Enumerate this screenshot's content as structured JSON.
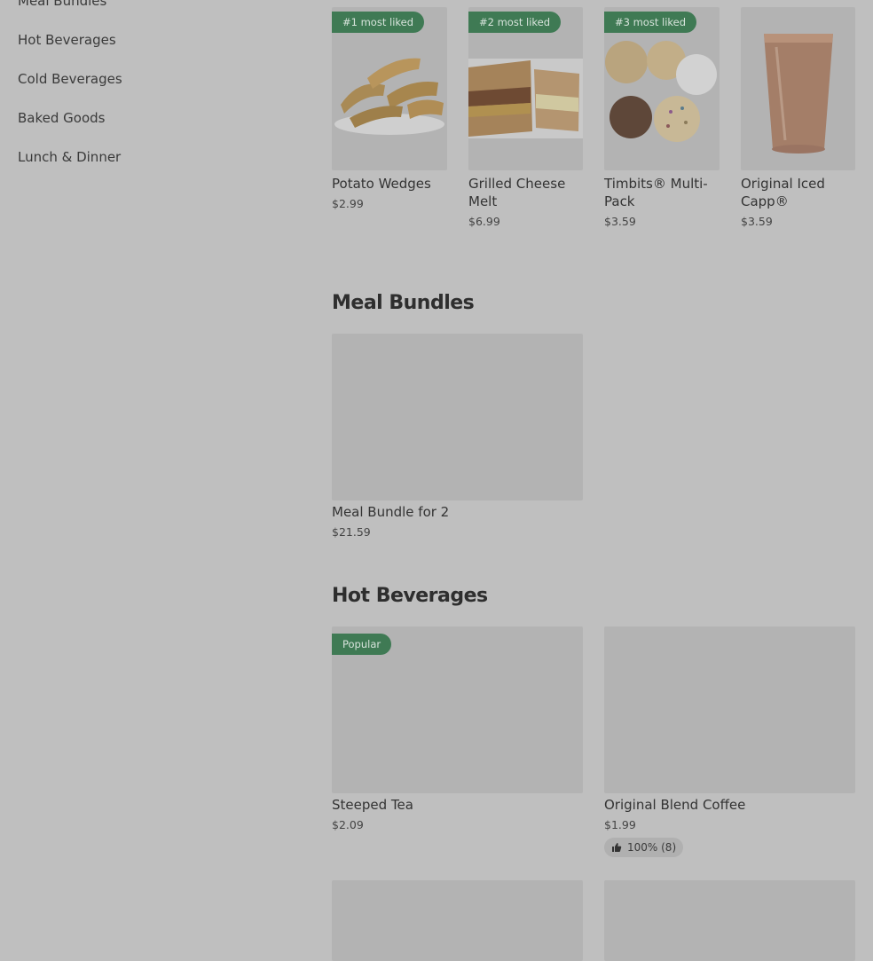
{
  "sidebar": {
    "items": [
      {
        "label": "Meal Bundles"
      },
      {
        "label": "Hot Beverages"
      },
      {
        "label": "Cold Beverages"
      },
      {
        "label": "Baked Goods"
      },
      {
        "label": "Lunch & Dinner"
      }
    ]
  },
  "most_liked": [
    {
      "badge": "#1 most liked",
      "name": "Potato Wedges",
      "price": "$2.99",
      "image": "potato-wedges-image"
    },
    {
      "badge": "#2 most liked",
      "name": "Grilled Cheese Melt",
      "price": "$6.99",
      "image": "grilled-cheese-image"
    },
    {
      "badge": "#3 most liked",
      "name": "Timbits® Multi-Pack",
      "price": "$3.59",
      "image": "timbits-image"
    },
    {
      "badge": "",
      "name": "Original Iced Capp®",
      "price": "$3.59",
      "image": "iced-capp-image"
    }
  ],
  "meal_bundles": {
    "title": "Meal Bundles",
    "items": [
      {
        "name": "Meal Bundle for 2",
        "price": "$21.59"
      }
    ]
  },
  "hot_beverages": {
    "title": "Hot Beverages",
    "items": [
      {
        "badge": "Popular",
        "name": "Steeped Tea",
        "price": "$2.09"
      },
      {
        "name": "Original Blend Coffee",
        "price": "$1.99",
        "rating": "100% (8)",
        "rating_icon": "thumbs-up-icon"
      }
    ]
  },
  "colors": {
    "background": "#bfbfbf",
    "badge": "#3f7a54",
    "placeholder": "#b3b3b3"
  }
}
